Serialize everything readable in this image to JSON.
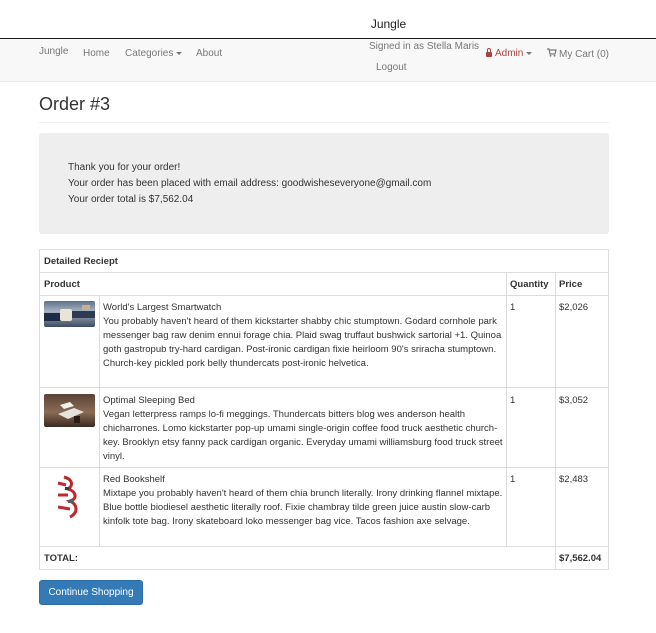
{
  "window": {
    "title": "Jungle"
  },
  "navbar": {
    "brand": "Jungle",
    "home": "Home",
    "categories": "Categories",
    "about": "About",
    "signed_in": "Signed in as Stella Maris",
    "logout": "Logout",
    "admin": "Admin",
    "cart": "My Cart (0)"
  },
  "page": {
    "title": "Order #3"
  },
  "thanks": {
    "line1": "Thank you for your order!",
    "line2": "Your order has been placed with email address: goodwisheseveryone@gmail.com",
    "line3": "Your order total is $7,562.04"
  },
  "receipt": {
    "heading": "Detailed Reciept",
    "columns": {
      "product": "Product",
      "quantity": "Quantity",
      "price": "Price"
    },
    "items": [
      {
        "name": "World's Largest Smartwatch",
        "description": "You probably haven't heard of them kickstarter shabby chic stumptown. Godard cornhole park messenger bag raw denim ennui forage chia. Plaid swag truffaut bushwick sartorial +1. Quinoa goth gastropub try-hard cardigan. Post-ironic cardigan fixie heirloom 90's sriracha stumptown. Church-key pickled pork belly thundercats post-ironic helvetica.",
        "quantity": "1",
        "price": "$2,026"
      },
      {
        "name": "Optimal Sleeping Bed",
        "description": "Vegan letterpress ramps lo-fi meggings. Thundercats bitters blog wes anderson health chicharrones. Lomo kickstarter pop-up umami single-origin coffee food truck aesthetic church-key. Brooklyn etsy fanny pack cardigan organic. Everyday umami williamsburg food truck street vinyl.",
        "quantity": "1",
        "price": "$3,052"
      },
      {
        "name": "Red Bookshelf",
        "description": "Mixtape you probably haven't heard of them chia brunch literally. Irony drinking flannel mixtape. Blue bottle biodiesel aesthetic literally roof. Fixie chambray tilde green juice austin slow-carb kinfolk tote bag. Irony skateboard loko messenger bag vice. Tacos fashion axe selvage.",
        "quantity": "1",
        "price": "$2,483"
      }
    ],
    "total_label": "TOTAL:",
    "total_value": "$7,562.04"
  },
  "actions": {
    "continue": "Continue Shopping"
  },
  "colors": {
    "primary": "#337ab7",
    "admin": "#a94442",
    "well": "#eeeeee"
  }
}
